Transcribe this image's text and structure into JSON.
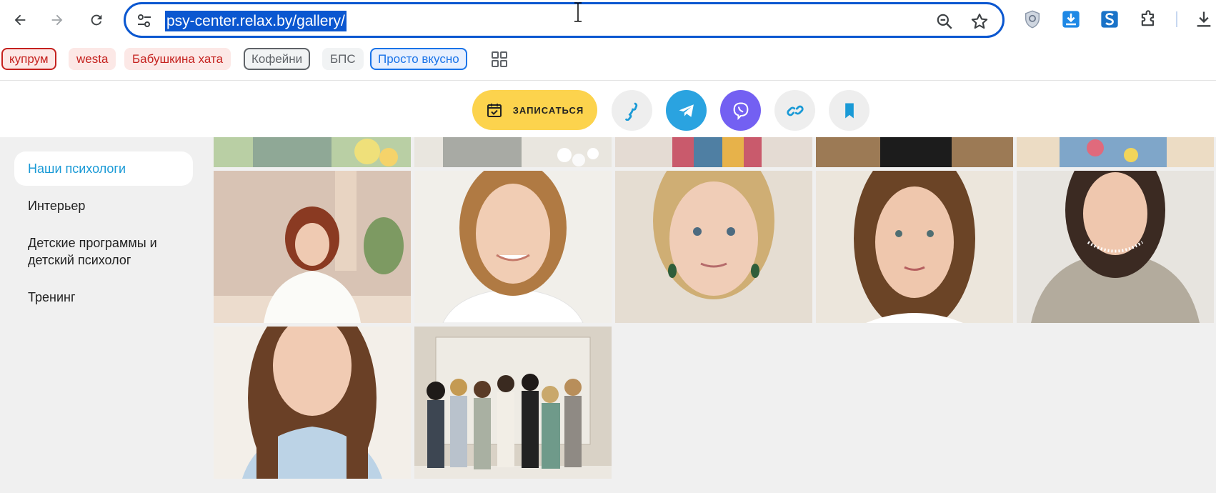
{
  "browser": {
    "url": "psy-center.relax.by/gallery/",
    "bookmarks": [
      "купрум",
      "westa",
      "Бабушкина хата",
      "Кофейни",
      "БПС",
      "Просто вкусно"
    ],
    "accent_color": "#0b57d0"
  },
  "site": {
    "book_button": "ЗАПИСАТЬСЯ",
    "book_color": "#fcd34d",
    "sidebar": [
      "Наши психологи",
      "Интерьер",
      "Детские программы и детский психолог",
      "Тренинг"
    ],
    "active_sidebar": "Наши психологи",
    "accent_color": "#1a9ad6"
  }
}
